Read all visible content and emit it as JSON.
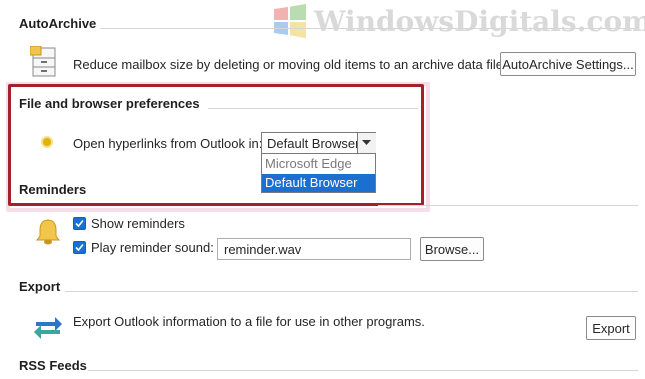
{
  "watermark": {
    "text": "WindowsDigitals.com"
  },
  "autoarchive": {
    "title": "AutoArchive",
    "description": "Reduce mailbox size by deleting or moving old items to an archive data file.",
    "settings_button": "AutoArchive Settings...",
    "icon": "archive-cabinet-icon"
  },
  "file_browser": {
    "title": "File and browser preferences",
    "label": "Open hyperlinks from Outlook in:",
    "selected": "Default Browser",
    "options": [
      "Microsoft Edge",
      "Default Browser"
    ],
    "icon": "yellow-dot-icon"
  },
  "reminders": {
    "title": "Reminders",
    "show_reminders": "Show reminders",
    "play_sound": "Play reminder sound:",
    "sound_file": "reminder.wav",
    "browse_button": "Browse...",
    "icon": "bell-icon"
  },
  "export": {
    "title": "Export",
    "description": "Export Outlook information to a file for use in other programs.",
    "button": "Export",
    "icon": "arrows-exchange-icon"
  },
  "rss": {
    "title": "RSS Feeds"
  },
  "colors": {
    "highlight_box": "#a3222a",
    "pink_glow": "#f5c9e0",
    "selection_blue": "#1a6fd1",
    "checkbox_blue": "#1a6fd1"
  }
}
